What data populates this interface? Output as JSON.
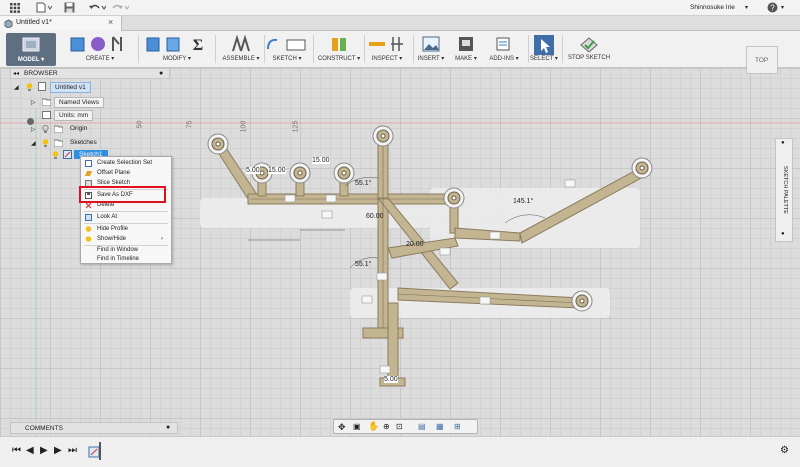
{
  "window": {
    "tab_title": "Untitled v1*",
    "user_name": "Shinnosuke Irie"
  },
  "ribbon": {
    "workspace": "MODEL",
    "groups": [
      "CREATE",
      "MODIFY",
      "ASSEMBLE",
      "SKETCH",
      "CONSTRUCT",
      "INSPECT",
      "INSERT",
      "MAKE",
      "ADD-INS",
      "SELECT",
      "STOP SKETCH"
    ],
    "viewcube_label": "TOP"
  },
  "browser": {
    "title": "BROWSER",
    "root": "Untitled v1",
    "items": [
      "Named Views",
      "Units: mm",
      "Origin",
      "Sketches",
      "Sketch1"
    ]
  },
  "context_menu": {
    "items": [
      "Create Selection Set",
      "Offset Plane",
      "Slice Sketch",
      "Save As DXF",
      "Delete",
      "Look At",
      "Hide Profile",
      "Show/Hide",
      "Find in Window",
      "Find in Timeline"
    ]
  },
  "canvas": {
    "ruler_labels": [
      "50",
      "75",
      "100",
      "125"
    ],
    "dimensions": [
      "5.00",
      "15.00",
      "15.00",
      "55.1°",
      "55.1°",
      "145.1°",
      "60.00",
      "20.00",
      "5.00",
      "15.00",
      "15.00",
      "5.00"
    ]
  },
  "sketch_palette_label": "SKETCH PALETTE",
  "comments_label": "COMMENTS",
  "accent_color": "#2f8fe0",
  "highlight_color": "#e0101e"
}
